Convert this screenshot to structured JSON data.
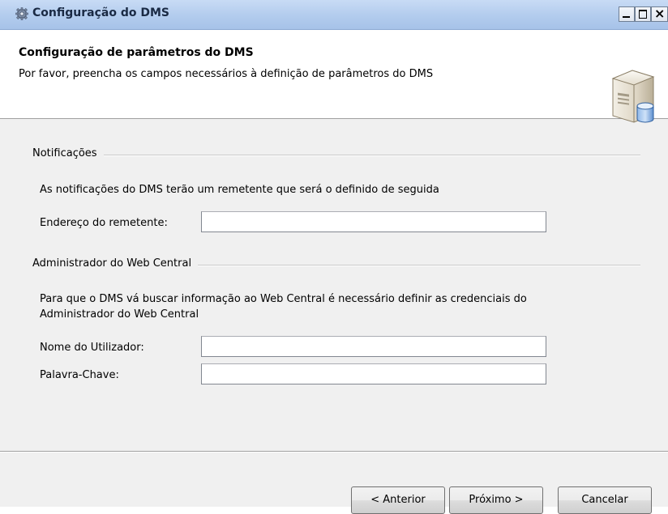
{
  "window": {
    "title": "Configuração do DMS",
    "icon": "gear-icon"
  },
  "header": {
    "title": "Configuração de parâmetros do DMS",
    "description": "Por favor, preencha os campos necessários à definição de parâmetros do DMS",
    "icon": "server-database-icon"
  },
  "notifications": {
    "section_label": "Notificações",
    "info": "As notificações do DMS terão um remetente que será o definido de seguida",
    "sender_label": "Endereço do remetente:",
    "sender_value": ""
  },
  "admin": {
    "section_label": "Administrador do Web Central",
    "info_line1": "Para que o DMS vá buscar informação ao Web Central é necessário definir as credenciais do",
    "info_line2": "Administrador do Web Central",
    "username_label": "Nome do Utilizador:",
    "username_value": "",
    "password_label": "Palavra-Chave:",
    "password_value": ""
  },
  "buttons": {
    "back": "< Anterior",
    "next": "Próximo >",
    "cancel": "Cancelar"
  },
  "colors": {
    "titlebar": "#b4cdee",
    "dialog_bg": "#f0f0f0",
    "header_bg": "#ffffff"
  }
}
